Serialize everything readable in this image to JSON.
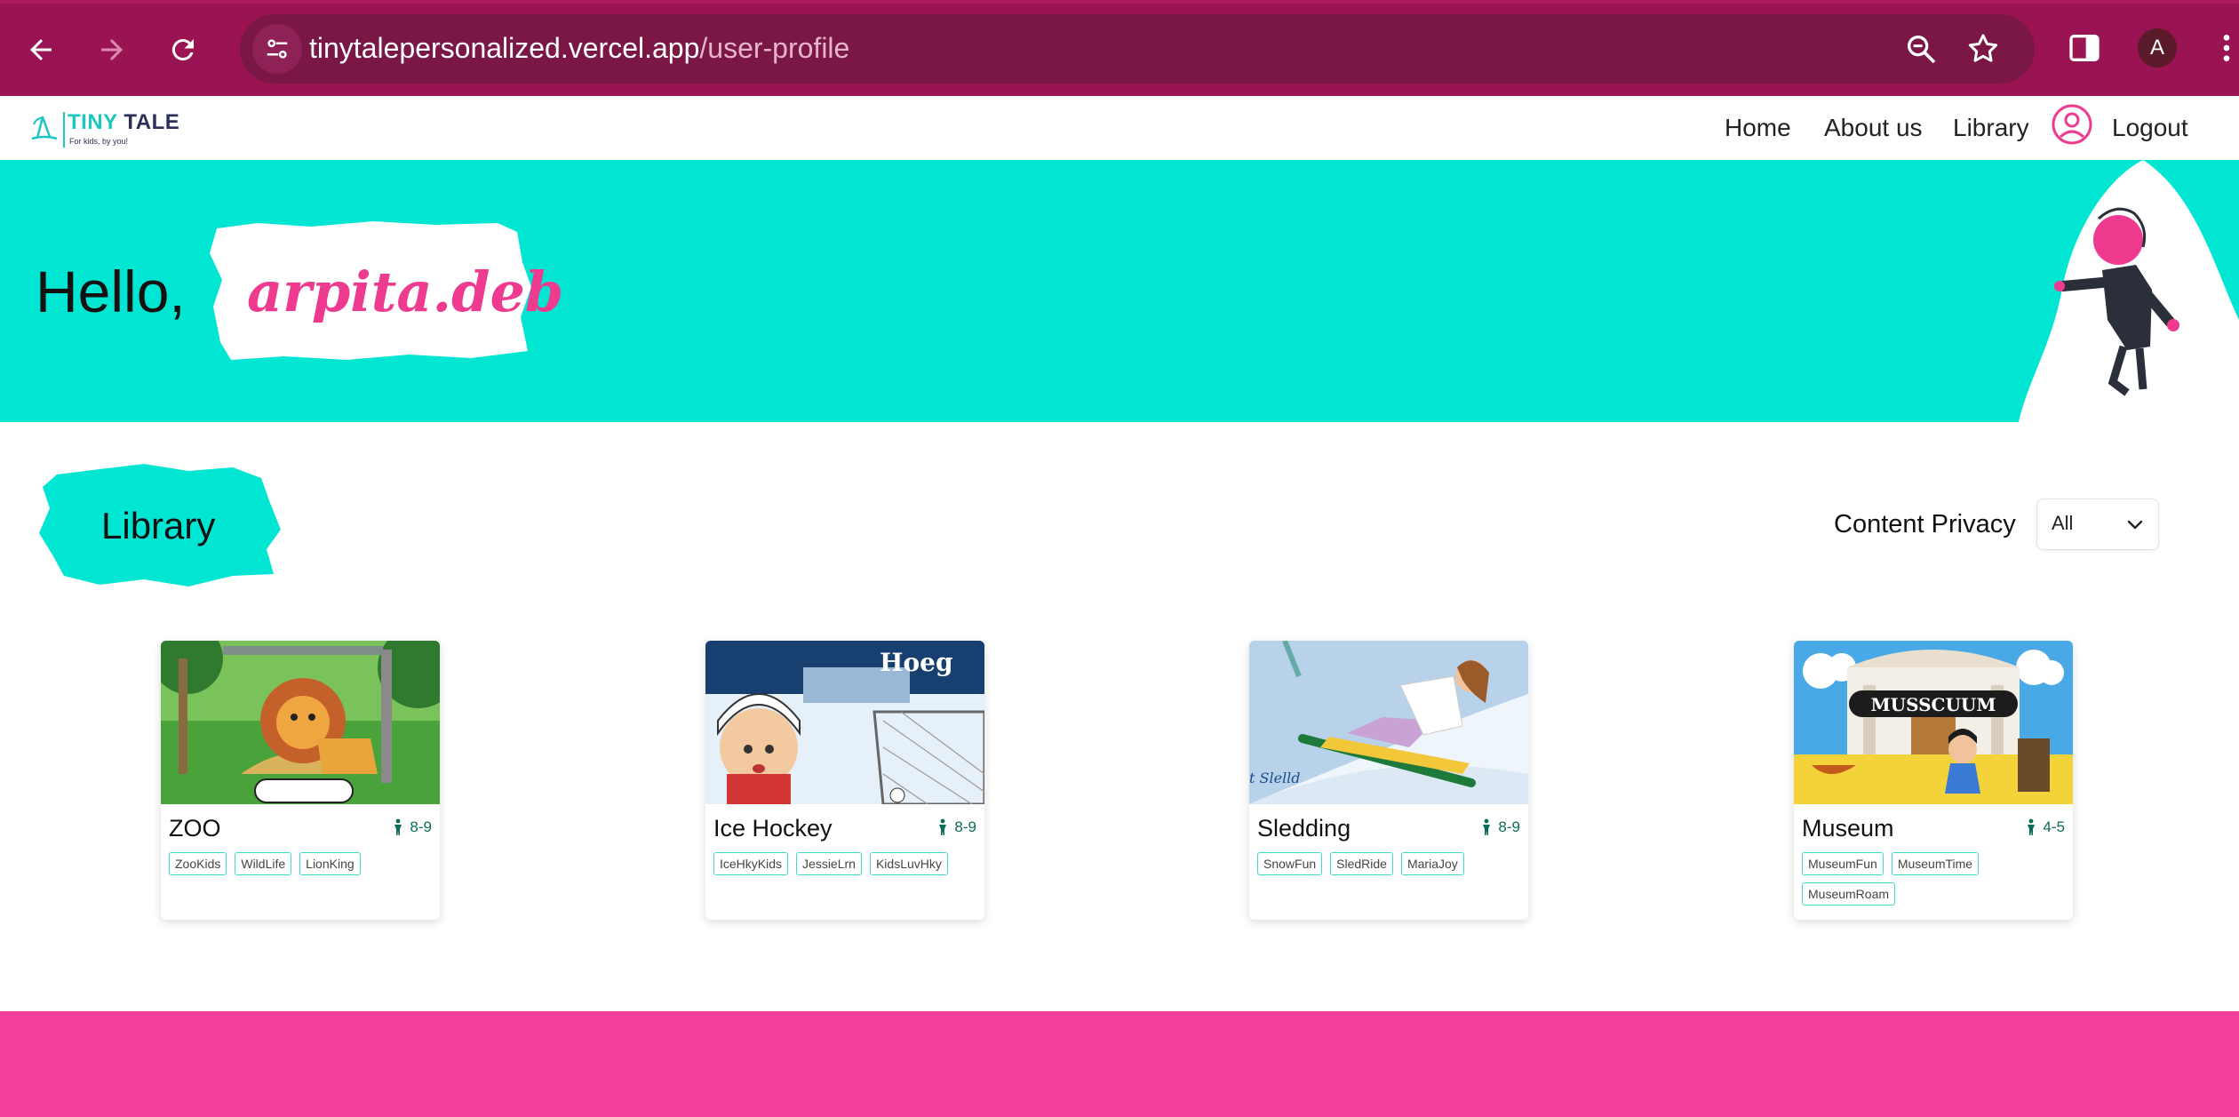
{
  "browser": {
    "url_host": "tinytalepersonalized.vercel.app",
    "url_path": "/user-profile",
    "profile_initial": "A",
    "colors": {
      "frame": "#9a1352",
      "omnibox": "#7a1745"
    }
  },
  "site": {
    "logo": {
      "title_a": "TINY",
      "title_b": "TALE",
      "tagline": "For kids, by you!"
    },
    "nav": [
      {
        "label": "Home"
      },
      {
        "label": "About us"
      },
      {
        "label": "Library"
      },
      {
        "label": "Logout"
      }
    ],
    "profile_icon": "user-circle-icon"
  },
  "hero": {
    "greeting": "Hello,",
    "username": "arpita.deb",
    "colors": {
      "background": "#00e6d2",
      "name": "#ef3b8f"
    }
  },
  "library": {
    "title": "Library",
    "privacy_label": "Content Privacy",
    "privacy_value": "All",
    "cards": [
      {
        "title": "ZOO",
        "age": "8-9",
        "tags": [
          "ZooKids",
          "WildLife",
          "LionKing"
        ],
        "image": "lion-zoo-illustration"
      },
      {
        "title": "Ice Hockey",
        "age": "8-9",
        "tags": [
          "IceHkyKids",
          "JessieLrn",
          "KidsLuvHky"
        ],
        "image": "ice-hockey-kid-illustration",
        "image_text": "Hoeg"
      },
      {
        "title": "Sledding",
        "age": "8-9",
        "tags": [
          "SnowFun",
          "SledRide",
          "MariaJoy"
        ],
        "image": "sledding-girl-illustration",
        "image_text": "t Slelld"
      },
      {
        "title": "Museum",
        "age": "4-5",
        "tags": [
          "MuseumFun",
          "MuseumTime",
          "MuseumRoam"
        ],
        "image": "museum-girl-illustration",
        "image_text": "MUSSCUUM"
      }
    ]
  },
  "footer": {
    "color": "#f5419b"
  }
}
